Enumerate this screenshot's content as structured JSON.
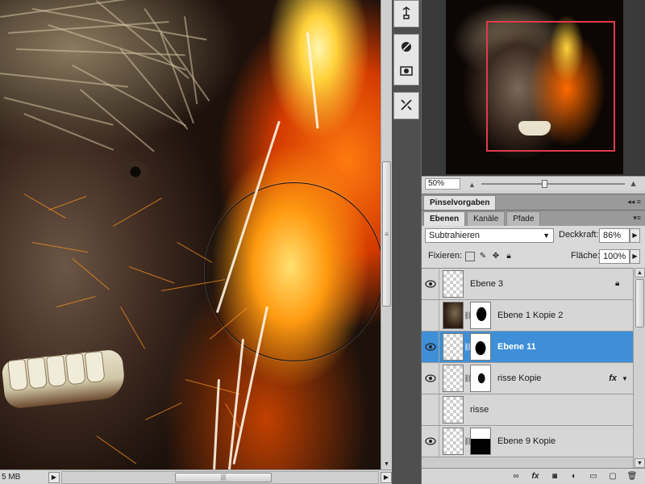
{
  "status": {
    "doc_size": "5 MB"
  },
  "tools": [
    {
      "name": "puppet-warp-icon"
    },
    {
      "name": "brush-icon"
    },
    {
      "name": "quick-mask-icon"
    },
    {
      "name": "tool-presets-icon"
    }
  ],
  "navigator": {
    "zoom": "50%"
  },
  "panels": {
    "brush_presets_tab": "Pinselvorgaben",
    "layers_tabs": [
      "Ebenen",
      "Kanäle",
      "Pfade"
    ],
    "menu_icon": "≡"
  },
  "layers": {
    "blend_mode": "Subtrahieren",
    "opacity_label": "Deckkraft:",
    "opacity": "86%",
    "lock_label": "Fixieren:",
    "fill_label": "Fläche:",
    "fill": "100%",
    "rows": [
      {
        "name": "Ebene 3",
        "visible": true,
        "locked": true,
        "mask": false,
        "fx": false,
        "selected": false
      },
      {
        "name": "Ebene 1 Kopie 2",
        "visible": false,
        "locked": false,
        "mask": true,
        "fx": false,
        "selected": false
      },
      {
        "name": "Ebene 11",
        "visible": true,
        "locked": false,
        "mask": true,
        "fx": false,
        "selected": true
      },
      {
        "name": "risse Kopie",
        "visible": true,
        "locked": false,
        "mask": true,
        "fx": true,
        "fx_label": "fx",
        "selected": false
      },
      {
        "name": "risse",
        "visible": false,
        "locked": false,
        "mask": false,
        "fx": false,
        "selected": false
      },
      {
        "name": "Ebene 9 Kopie",
        "visible": true,
        "locked": false,
        "mask": true,
        "fx": false,
        "selected": false
      }
    ]
  },
  "footer_icons": [
    "link-icon",
    "fx-icon",
    "add-mask-icon",
    "adjustment-icon",
    "new-group-icon",
    "new-layer-icon",
    "trash-icon"
  ],
  "colors": {
    "selection_blue": "#3e8fd8",
    "nav_viewbox": "#e03a4a"
  }
}
